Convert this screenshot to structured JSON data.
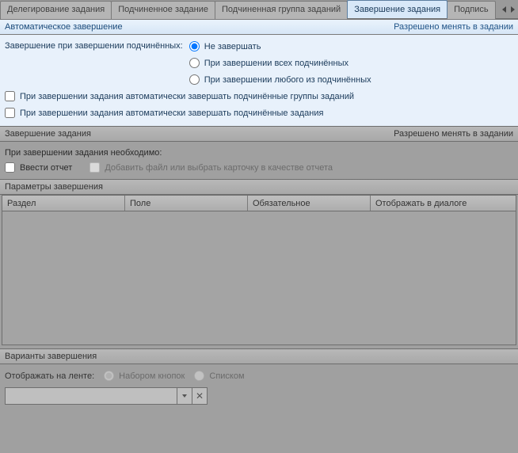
{
  "tabs": {
    "items": [
      "Делегирование задания",
      "Подчиненное задание",
      "Подчиненная группа заданий",
      "Завершение задания",
      "Подпись"
    ],
    "activeIndex": 3
  },
  "autoComplete": {
    "title": "Автоматическое завершение",
    "permission": "Разрешено менять в задании",
    "leadLabel": "Завершение при завершении подчинённых:",
    "options": [
      "Не завершать",
      "При завершении всех подчинённых",
      "При завершении любого из подчинённых"
    ],
    "selectedOption": 0,
    "chkGroups": "При завершении задания автоматически завершать подчинённые группы заданий",
    "chkTasks": "При завершении задания автоматически завершать подчинённые задания"
  },
  "completion": {
    "title": "Завершение задания",
    "permission": "Разрешено менять в задании",
    "need": "При завершении задания необходимо:",
    "chkReport": "Ввести отчет",
    "chkFile": "Добавить файл или выбрать карточку в качестве отчета",
    "paramsTitle": "Параметры завершения",
    "columns": [
      "Раздел",
      "Поле",
      "Обязательное",
      "Отображать в диалоге"
    ]
  },
  "variants": {
    "title": "Варианты завершения",
    "ribbonLabel": "Отображать на ленте:",
    "optButtons": "Набором кнопок",
    "optList": "Списком",
    "comboValue": ""
  }
}
